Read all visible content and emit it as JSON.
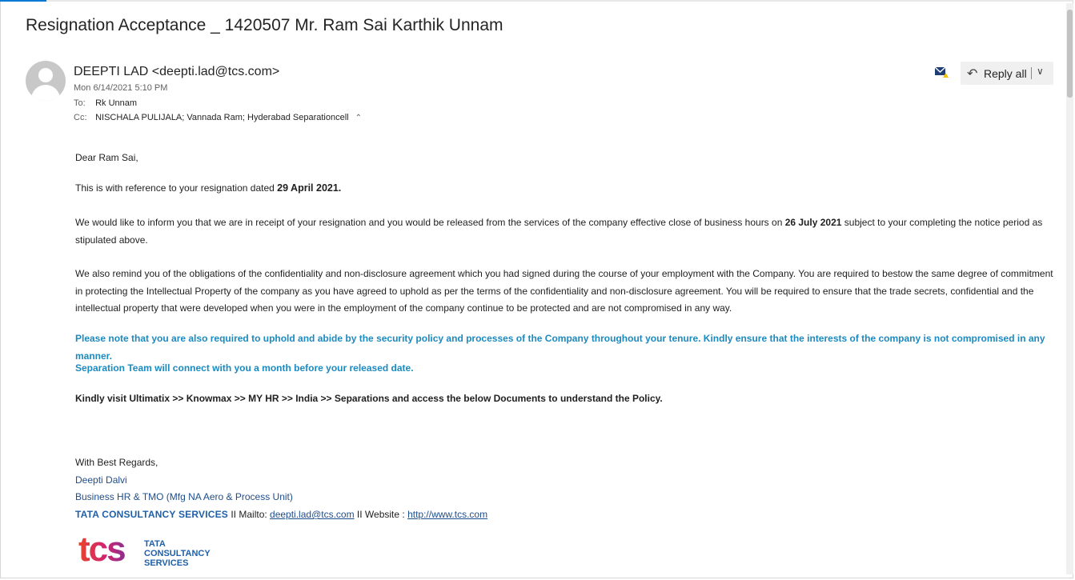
{
  "email": {
    "subject": "Resignation Acceptance _ 1420507 Mr. Ram Sai Karthik Unnam",
    "sender": "DEEPTI LAD <deepti.lad@tcs.com>",
    "sent": "Mon 6/14/2021 5:10 PM",
    "to_label": "To:",
    "to": "Rk Unnam",
    "cc_label": "Cc:",
    "cc": "NISCHALA PULIJALA; Vannada Ram; Hyderabad Separationcell"
  },
  "toolbar": {
    "reply_all_label": "Reply all",
    "reply_icon": "reply-all-arrow",
    "envelope_icon": "mark-unread-envelope",
    "accent_color": "#0078d4"
  },
  "body": {
    "greeting": "Dear Ram Sai,",
    "p1_prefix": "This is with reference to your resignation dated ",
    "p1_date": "29 April 2021.",
    "p2_prefix": "We would like to inform you that we are in receipt of your resignation and you would be released from the services of the company effective close of business hours on ",
    "p2_date": "26 July 2021",
    "p2_suffix": " subject to your completing the notice period as stipulated above.",
    "p3": "We also remind you of the obligations of the confidentiality and non-disclosure agreement which you had signed during the course of your employment with the Company. You are required to bestow the same degree of commitment in protecting the Intellectual Property of the company as you have agreed to uphold as per the terms of the confidentiality and non-disclosure agreement. You will be required to ensure that the trade secrets, confidential and the intellectual property that were developed when you were in the employment of the company continue to be protected and are not compromised in any way.",
    "p4": "Please note that you are also required to uphold and abide by the security policy and processes of the Company throughout your tenure. Kindly ensure that the interests of the company is not compromised in any manner.",
    "p5": "Separation Team will connect with you a month before your released date.",
    "p6": "Kindly visit Ultimatix >> Knowmax >> MY HR >> India >> Separations and access the below Documents to understand the Policy.",
    "highlight_color": "#1b8ac0"
  },
  "signature": {
    "closing": "With Best Regards,",
    "name": "Deepti Dalvi",
    "role": "Business HR & TMO  (Mfg NA Aero & Process Unit)",
    "company_wordmark": "TATA CONSULTANCY SERVICES",
    "mailto_label": " II Mailto: ",
    "mailto": "deepti.lad@tcs.com",
    "website_label": " II Website : ",
    "website": "http://www.tcs.com",
    "logo": {
      "mark": "tcs",
      "line1": "TATA",
      "line2": "CONSULTANCY",
      "line3": "SERVICES"
    }
  }
}
